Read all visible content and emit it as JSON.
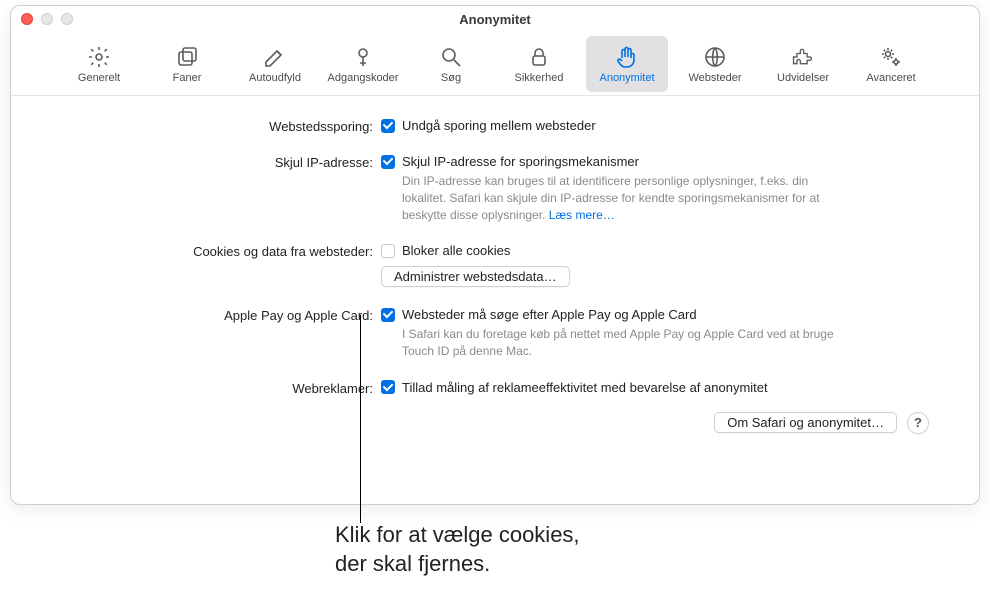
{
  "window": {
    "title": "Anonymitet"
  },
  "toolbar": {
    "items": [
      {
        "label": "Generelt"
      },
      {
        "label": "Faner"
      },
      {
        "label": "Autoudfyld"
      },
      {
        "label": "Adgangskoder"
      },
      {
        "label": "Søg"
      },
      {
        "label": "Sikkerhed"
      },
      {
        "label": "Anonymitet"
      },
      {
        "label": "Websteder"
      },
      {
        "label": "Udvidelser"
      },
      {
        "label": "Avanceret"
      }
    ],
    "active_index": 6
  },
  "settings": {
    "tracking": {
      "label": "Webstedssporing:",
      "checkbox_label": "Undgå sporing mellem websteder",
      "checked": true
    },
    "hide_ip": {
      "label": "Skjul IP-adresse:",
      "checkbox_label": "Skjul IP-adresse for sporingsmekanismer",
      "checked": true,
      "hint": "Din IP-adresse kan bruges til at identificere personlige oplysninger, f.eks. din lokalitet. Safari kan skjule din IP-adresse for kendte sporingsmekanismer for at beskytte disse oplysninger.",
      "learn_more": "Læs mere…"
    },
    "cookies": {
      "label": "Cookies og data fra websteder:",
      "checkbox_label": "Bloker alle cookies",
      "checked": false,
      "manage_button": "Administrer webstedsdata…"
    },
    "apple_pay": {
      "label": "Apple Pay og Apple Card:",
      "checkbox_label": "Websteder må søge efter Apple Pay og Apple Card",
      "checked": true,
      "hint": "I Safari kan du foretage køb på nettet med Apple Pay og Apple Card ved at bruge Touch ID på denne Mac."
    },
    "ads": {
      "label": "Webreklamer:",
      "checkbox_label": "Tillad måling af reklameeffektivitet med bevarelse af anonymitet",
      "checked": true
    }
  },
  "footer": {
    "about_button": "Om Safari og anonymitet…",
    "help": "?"
  },
  "callout": {
    "line1": "Klik for at vælge cookies,",
    "line2": "der skal fjernes."
  }
}
